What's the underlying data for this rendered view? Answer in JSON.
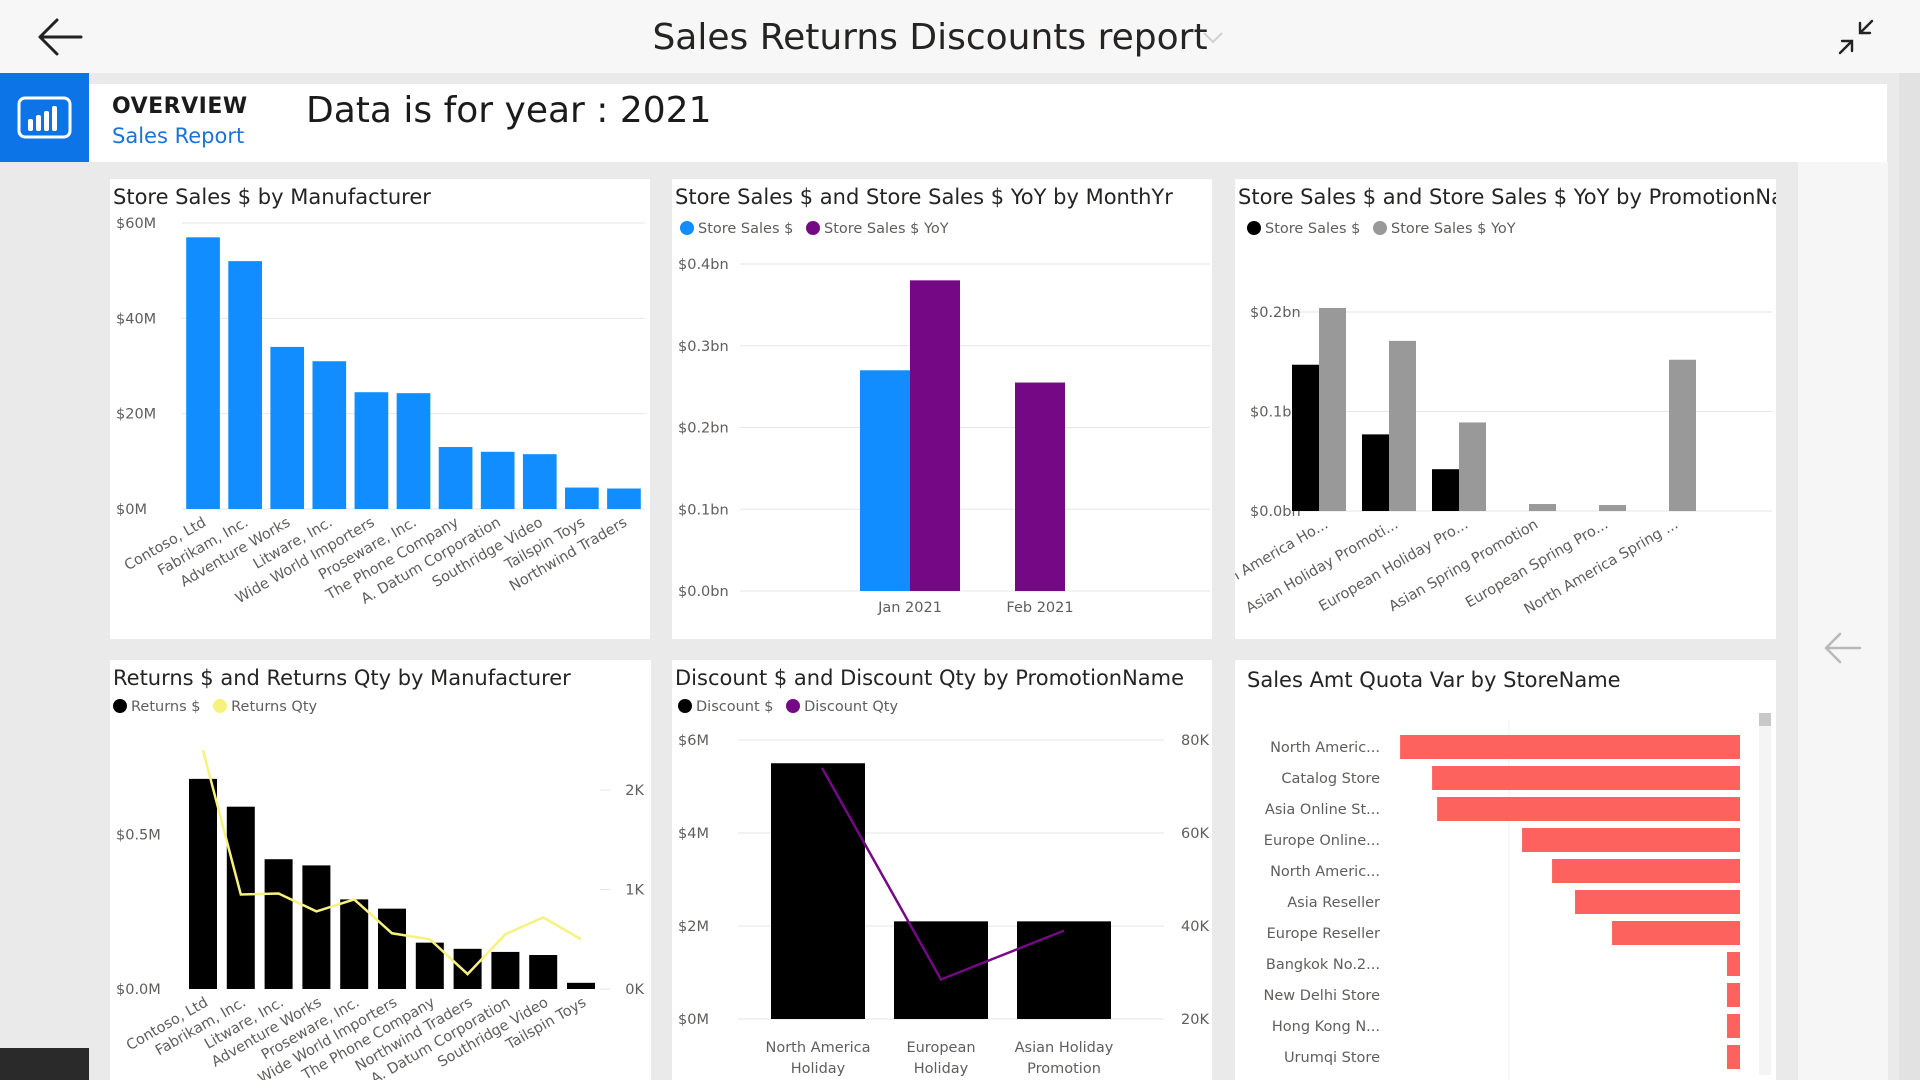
{
  "header": {
    "title": "Sales Returns Discounts report",
    "nav_label": "OVERVIEW",
    "nav_sub": "Sales Report",
    "year_text": "Data is for year : 2021"
  },
  "icons": {
    "back": "arrow-left-icon",
    "collapse": "collapse-icon",
    "chevron": "chevron-down-icon",
    "logo": "power-bi-logo-icon",
    "prev_page": "arrow-left-icon"
  },
  "colors": {
    "blue": "#118dff",
    "purple": "#750985",
    "black": "#000000",
    "grey": "#999999",
    "yellow": "#f7f17f",
    "salmon": "#fd625e",
    "accent": "#0d74e8"
  },
  "chart_data": [
    {
      "id": "c1",
      "title": "Store Sales $ by Manufacturer",
      "type": "bar",
      "categories": [
        "Contoso, Ltd",
        "Fabrikam, Inc.",
        "Adventure Works",
        "Litware, Inc.",
        "Wide World Importers",
        "Proseware, Inc.",
        "The Phone Company",
        "A. Datum Corporation",
        "Southridge Video",
        "Tailspin Toys",
        "Northwind Traders"
      ],
      "values": [
        57,
        52,
        34,
        31,
        24.5,
        24.3,
        13,
        12,
        11.5,
        4.5,
        4.3
      ],
      "unit": "M",
      "ylim": [
        0,
        60
      ],
      "yticks": [
        "$0M",
        "$20M",
        "$40M",
        "$60M"
      ],
      "color": "#118dff"
    },
    {
      "id": "c2",
      "title": "Store Sales $ and Store Sales $ YoY by MonthYr",
      "type": "bar",
      "categories": [
        "Jan 2021",
        "Feb 2021"
      ],
      "series": [
        {
          "name": "Store Sales $",
          "values": [
            0.27,
            0
          ],
          "color": "#118dff"
        },
        {
          "name": "Store Sales $ YoY",
          "values": [
            0.38,
            0.255
          ],
          "color": "#750985"
        }
      ],
      "ylim": [
        0,
        0.4
      ],
      "yticks": [
        "$0.0bn",
        "$0.1bn",
        "$0.2bn",
        "$0.3bn",
        "$0.4bn"
      ]
    },
    {
      "id": "c3",
      "title": "Store Sales $ and Store Sales $ YoY by PromotionName",
      "type": "bar",
      "categories": [
        "North America Ho...",
        "Asian Holiday Promoti...",
        "European Holiday Pro...",
        "Asian Spring Promotion",
        "European Spring Pro...",
        "North America Spring ..."
      ],
      "series": [
        {
          "name": "Store Sales $",
          "values": [
            0.147,
            0.077,
            0.042,
            0,
            0,
            0
          ],
          "color": "#000000"
        },
        {
          "name": "Store Sales $ YoY",
          "values": [
            0.204,
            0.171,
            0.089,
            0.007,
            0.006,
            0.152
          ],
          "color": "#999999"
        }
      ],
      "ylim": [
        0,
        0.2
      ],
      "yticks": [
        "$0.0bn",
        "$0.1bn",
        "$0.2bn"
      ]
    },
    {
      "id": "c4",
      "title": "Returns $ and Returns Qty by Manufacturer",
      "type": "bar",
      "categories": [
        "Contoso, Ltd",
        "Fabrikam, Inc.",
        "Litware, Inc.",
        "Adventure Works",
        "Proseware, Inc.",
        "Wide World Importers",
        "The Phone Company",
        "Northwind Traders",
        "A. Datum Corporation",
        "Southridge Video",
        "Tailspin Toys"
      ],
      "series": [
        {
          "name": "Returns $",
          "values": [
            0.68,
            0.59,
            0.42,
            0.4,
            0.29,
            0.26,
            0.15,
            0.13,
            0.12,
            0.11,
            0.02
          ],
          "color": "#000000"
        },
        {
          "name": "Returns Qty",
          "type": "line",
          "values": [
            2400,
            950,
            960,
            780,
            900,
            560,
            500,
            150,
            550,
            720,
            500
          ],
          "color": "#f7f17f"
        }
      ],
      "ylim": [
        0,
        1.0
      ],
      "y2lim": [
        0,
        2800
      ],
      "yticks": [
        "$0.0M",
        "$0.5M"
      ],
      "y2ticks": [
        "0K",
        "1K",
        "2K"
      ]
    },
    {
      "id": "c5",
      "title": "Discount $ and Discount Qty by PromotionName",
      "type": "bar",
      "categories": [
        [
          "North America",
          "Holiday"
        ],
        [
          "European",
          "Holiday"
        ],
        [
          "Asian Holiday",
          "Promotion"
        ]
      ],
      "series": [
        {
          "name": "Discount $",
          "values": [
            5.5,
            2.1,
            2.1
          ],
          "color": "#000000"
        },
        {
          "name": "Discount Qty",
          "type": "line",
          "values": [
            74000,
            28500,
            39000
          ],
          "color": "#750985"
        }
      ],
      "ylim": [
        0,
        6
      ],
      "y2lim": [
        20000,
        80000
      ],
      "yticks": [
        "$0M",
        "$2M",
        "$4M",
        "$6M"
      ],
      "y2ticks": [
        "20K",
        "40K",
        "60K",
        "80K"
      ]
    },
    {
      "id": "c6",
      "title": "Sales Amt Quota Var by StoreName",
      "type": "bar",
      "orientation": "horizontal",
      "categories": [
        "North Americ...",
        "Catalog Store",
        "Asia Online St...",
        "Europe Online...",
        "North Americ...",
        "Asia Reseller",
        "Europe Reseller",
        "Bangkok No.2...",
        "New Delhi Store",
        "Hong Kong N...",
        "Urumqi Store"
      ],
      "values": [
        -340,
        -308,
        -303,
        -218,
        -188,
        -165,
        -128,
        -13,
        -13,
        -13,
        -13
      ],
      "color": "#fd625e"
    }
  ]
}
